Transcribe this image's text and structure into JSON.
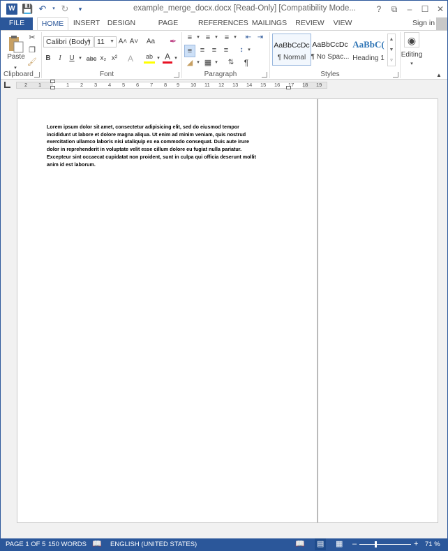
{
  "window": {
    "title": "example_merge_docx.docx [Read-Only] [Compatibility Mode...",
    "controls": [
      "?",
      "⧉",
      "–",
      "☐",
      "✕"
    ]
  },
  "tabs": [
    {
      "label": "FILE"
    },
    {
      "label": "HOME"
    },
    {
      "label": "INSERT"
    },
    {
      "label": "DESIGN"
    },
    {
      "label": "PAGE LAYOUT"
    },
    {
      "label": "REFERENCES"
    },
    {
      "label": "MAILINGS"
    },
    {
      "label": "REVIEW"
    },
    {
      "label": "VIEW"
    }
  ],
  "account": {
    "signin": "Sign in"
  },
  "ribbon": {
    "clipboard": {
      "label": "Clipboard",
      "paste": "Paste"
    },
    "font": {
      "label": "Font",
      "family": "Calibri (Body)",
      "size": "11",
      "grow": "A˄",
      "shrink": "A˅",
      "case": "Aa",
      "bold": "B",
      "italic": "I",
      "underline": "U",
      "strike": "abc",
      "subscript": "x₂",
      "superscript": "x²",
      "effects": "A",
      "highlight": "ab",
      "color": "A"
    },
    "paragraph": {
      "label": "Paragraph",
      "pilcrow": "¶"
    },
    "styles": {
      "label": "Styles",
      "items": [
        {
          "preview": "AaBbCcDc",
          "name": "¶ Normal"
        },
        {
          "preview": "AaBbCcDc",
          "name": "¶ No Spac..."
        },
        {
          "preview": "AaBbC(",
          "name": "Heading 1"
        }
      ]
    },
    "editing": {
      "label": "Editing"
    }
  },
  "ruler": {
    "ticks": [
      "2",
      "1",
      "1",
      "2",
      "3",
      "4",
      "5",
      "6",
      "7",
      "8",
      "9",
      "10",
      "11",
      "12",
      "13",
      "14",
      "15",
      "16",
      "17",
      "18",
      "19"
    ]
  },
  "document": {
    "body": "Lorem ipsum dolor sit amet, consectetur adipisicing elit, sed do eiusmod tempor incididunt ut labore et dolore magna aliqua. Ut enim ad minim veniam, quis nostrud exercitation ullamco laboris nisi utaliquip ex ea commodo consequat. Duis aute irure dolor in reprehenderit in voluptate velit esse cillum dolore eu fugiat nulla pariatur. Excepteur sint occaecat cupidatat non proident, sunt in culpa qui officia deserunt mollit anim id est laborum."
  },
  "status": {
    "page": "PAGE 1 OF 5",
    "words": "150 WORDS",
    "language": "ENGLISH (UNITED STATES)",
    "zoom_minus": "–",
    "zoom_plus": "+",
    "zoom": "71 %",
    "zoom_level_percent": 71
  },
  "colors": {
    "brand": "#2b579a",
    "canvas": "#f1f1f1"
  }
}
